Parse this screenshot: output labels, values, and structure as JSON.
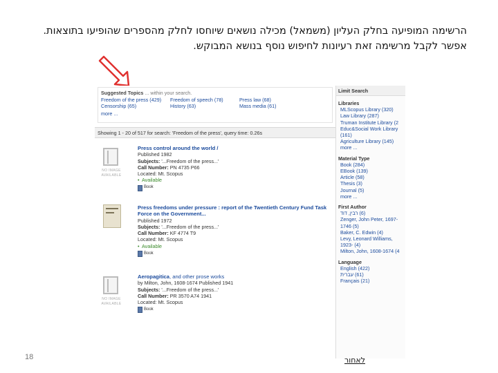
{
  "slide": {
    "line1": "הרשימה המופיעה בחלק העליון (משמאל) מכילה נושאים שיוחסו לחלק מהספרים שהופיעו בתוצאות.",
    "line2": "אפשר לקבל מרשימה זאת רעיונות לחיפוש נוסף בנושא המבוקש.",
    "page_number": "18",
    "back_label": "לאחור",
    "arrow_color": "#e0312f"
  },
  "suggested": {
    "title": "Suggested Topics",
    "title_suffix": "... within your search.",
    "topics": [
      "Freedom of the press (429)",
      "Freedom of speech (78)",
      "Press law (68)",
      "Censorship (65)",
      "History (63)",
      "Mass media (61)"
    ],
    "more": "more ..."
  },
  "results_bar": "Showing 1 - 20 of 517 for search: 'Freedom of the press', query time: 0.26s",
  "results": [
    {
      "title": "Press control around the world /",
      "published": "Published 1982",
      "subjects_label": "Subjects:",
      "subjects": "'...Freedom of the press...'",
      "call_label": "Call Number:",
      "call": "PN 4735 P66",
      "located": "Located: Mt. Scopus",
      "available": "Available",
      "format": "Book",
      "noimg": "NO IMAGE AVAILABLE"
    },
    {
      "title": "Press freedoms under pressure : report of the Twentieth Century Fund Task Force on the Government...",
      "published": "Published 1972",
      "subjects_label": "Subjects:",
      "subjects": "'...Freedom of the press...'",
      "call_label": "Call Number:",
      "call": "KF 4774 T9",
      "located": "Located: Mt. Scopus",
      "available": "Available",
      "format": "Book"
    },
    {
      "title_bold": "Aeropagitica",
      "title_rest": ", and other prose works",
      "author_line": "by Milton, John, 1608-1674 Published 1941",
      "subjects_label": "Subjects:",
      "subjects": "'...Freedom of the press...'",
      "call_label": "Call Number:",
      "call": "PR 3570 A74 1941",
      "located": "Located: Mt. Scopus",
      "format": "Book",
      "noimg": "NO IMAGE AVAILABLE"
    }
  ],
  "sidebar": {
    "header": "Limit Search",
    "sections": [
      {
        "title": "Libraries",
        "items": [
          "MLScopus Library (320)",
          "Law Library (287)",
          "Truman Institute Library (2",
          "Educ&Social Work Library (161)",
          "Agriculture Library (145)",
          "more ..."
        ]
      },
      {
        "title": "Material Type",
        "items": [
          "Book (284)",
          "EBook (139)",
          "Article (58)",
          "Thesis (3)",
          "Journal (5)",
          "more ..."
        ]
      },
      {
        "title": "First Author",
        "items": [
          "(6) רבין, דוד",
          "Zenger, John Peter, 1697-1746 (5)",
          "Baker, C. Edwin (4)",
          "Levy, Leonard Williams, 1923- (4)",
          "Milton, John, 1608-1674 (4"
        ]
      },
      {
        "title": "Language",
        "items": [
          "English (422)",
          "(61) עברית",
          "Français (21)"
        ]
      }
    ]
  }
}
